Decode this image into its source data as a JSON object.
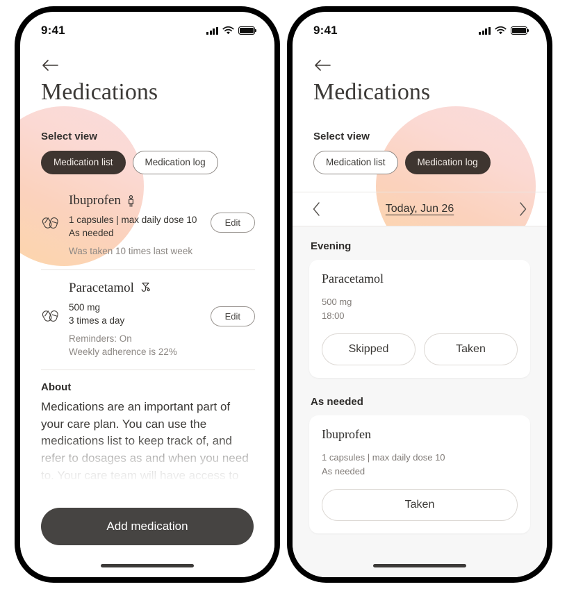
{
  "statusbar": {
    "time": "9:41",
    "signal_icon": "cellular-bars-icon",
    "wifi_icon": "wifi-icon",
    "battery_icon": "battery-full-icon"
  },
  "colors": {
    "accent_dark": "#3e3530",
    "cta": "#464442",
    "blob_from": "#fadcdc",
    "blob_to": "#fcd6a8",
    "log_background": "#f7f7f7",
    "muted_text": "#8d8884"
  },
  "left_phone": {
    "back_label": "Back",
    "title": "Medications",
    "select_view_label": "Select view",
    "tabs": [
      {
        "label": "Medication list",
        "active": true
      },
      {
        "label": "Medication log",
        "active": false
      }
    ],
    "medications": [
      {
        "name": "Ibuprofen",
        "tag_icon": "person-icon",
        "dose": "1 capsules | max daily dose 10",
        "schedule": "As needed",
        "notes": [
          "Was taken 10 times last week"
        ],
        "edit_label": "Edit"
      },
      {
        "name": "Paracetamol",
        "tag_icon": "stethoscope-icon",
        "dose": "500 mg",
        "schedule": "3 times a day",
        "notes": [
          "Reminders: On",
          "Weekly adherence is 22%"
        ],
        "edit_label": "Edit"
      }
    ],
    "about": {
      "title": "About",
      "body": "Medications are an important part of your care plan. You can use the medications list to keep track of, and refer to dosages as and when you need to. Your care team will have access to this list and can add medications when needed. Please note, the"
    },
    "cta_label": "Add medication"
  },
  "right_phone": {
    "back_label": "Back",
    "title": "Medications",
    "select_view_label": "Select view",
    "tabs": [
      {
        "label": "Medication list",
        "active": false
      },
      {
        "label": "Medication log",
        "active": true
      }
    ],
    "date_nav": {
      "prev_icon": "chevron-left-icon",
      "next_icon": "chevron-right-icon",
      "label": "Today, Jun 26"
    },
    "sections": [
      {
        "title": "Evening",
        "cards": [
          {
            "name": "Paracetamol",
            "meta": [
              "500 mg",
              "18:00"
            ],
            "actions": [
              "Skipped",
              "Taken"
            ]
          }
        ]
      },
      {
        "title": "As needed",
        "cards": [
          {
            "name": "Ibuprofen",
            "meta": [
              "1 capsules | max daily dose 10",
              "As needed"
            ],
            "actions": [
              "Taken"
            ]
          }
        ]
      }
    ]
  }
}
